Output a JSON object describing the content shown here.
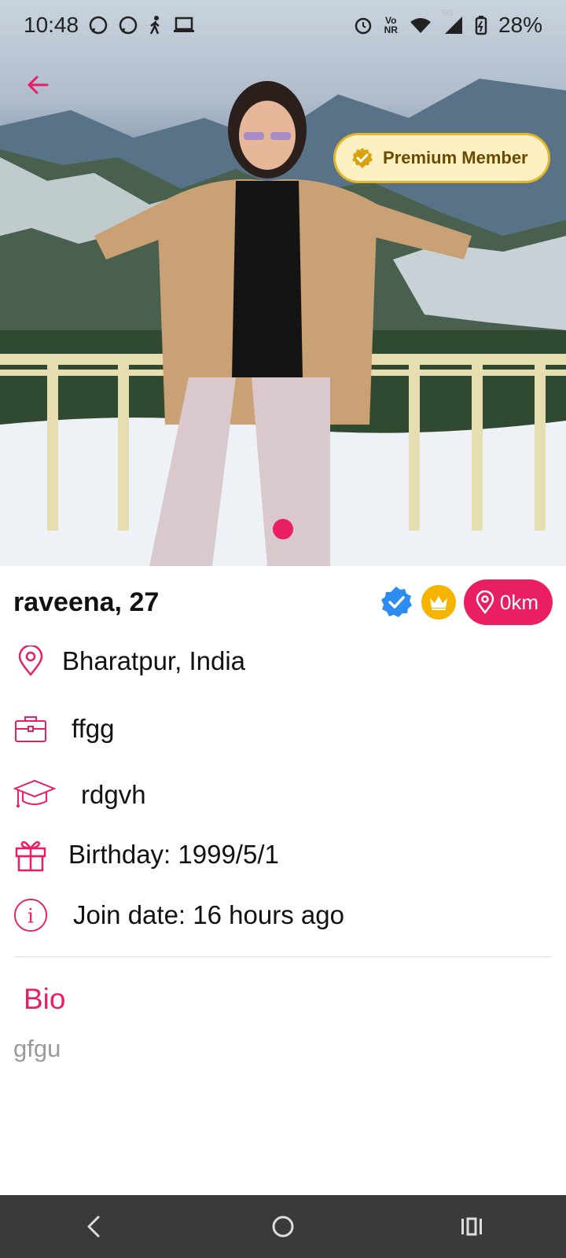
{
  "status_bar": {
    "time": "10:48",
    "network_top": "Vo",
    "network_bottom": "NR",
    "signal_label": "5G",
    "battery_percent": "28%"
  },
  "header": {
    "back_icon": "arrow-left-icon",
    "premium_label": "Premium Member"
  },
  "profile": {
    "name_age": "raveena, 27",
    "distance": "0km",
    "location": "Bharatpur, India",
    "job": "ffgg",
    "education": "rdgvh",
    "birthday": "Birthday: 1999/5/1",
    "join_date": "Join date: 16 hours ago"
  },
  "bio": {
    "title": "Bio",
    "text": "gfgu"
  },
  "colors": {
    "accent": "#e91e63",
    "premium_bg": "#fdf1c4",
    "premium_border": "#e4b52b",
    "verified": "#2d8cf0",
    "crown": "#f4b400",
    "navbar": "#3a3a3a"
  },
  "nav": {
    "icons": [
      "back-icon",
      "home-icon",
      "recents-icon"
    ]
  }
}
